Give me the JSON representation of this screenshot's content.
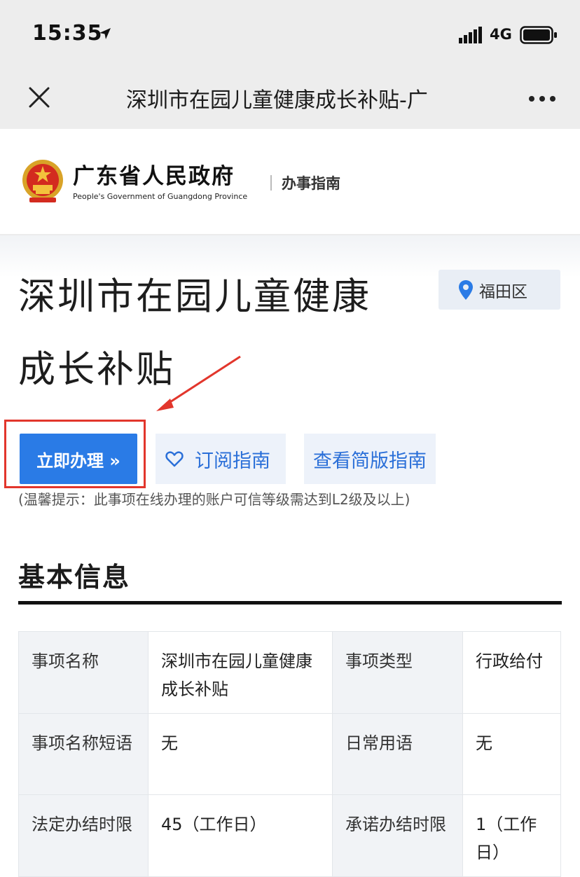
{
  "status_bar": {
    "time": "15:35",
    "network": "4G",
    "icons": [
      "location-arrow-icon",
      "signal-icon",
      "battery-icon"
    ]
  },
  "nav": {
    "title": "深圳市在园儿童健康成长补贴-广",
    "icons": [
      "close-icon",
      "more-icon"
    ]
  },
  "header": {
    "site_name": "广东省人民政府",
    "site_subtitle": "People's Government of Guangdong Province",
    "section": "办事指南",
    "icons": [
      "national-emblem-icon"
    ]
  },
  "main": {
    "title": "深圳市在园儿童健康成长补贴",
    "region": "福田区",
    "apply_button": "立即办理 »",
    "subscribe_button": "订阅指南",
    "simple_guide_button": "查看简版指南",
    "tip": "(温馨提示：此事项在线办理的账户可信等级需达到L2级及以上)"
  },
  "basic_info": {
    "title": "基本信息",
    "rows": [
      [
        "事项名称",
        "深圳市在园儿童健康成长补贴",
        "事项类型",
        "行政给付"
      ],
      [
        "事项名称短语",
        "无",
        "日常用语",
        "无"
      ],
      [
        "法定办结时限",
        "45（工作日）",
        "承诺办结时限",
        "1（工作日）"
      ]
    ]
  },
  "colors": {
    "primary_blue": "#2a7be6",
    "highlight_red": "#e2362c",
    "light_button_bg": "#edf2fa"
  }
}
